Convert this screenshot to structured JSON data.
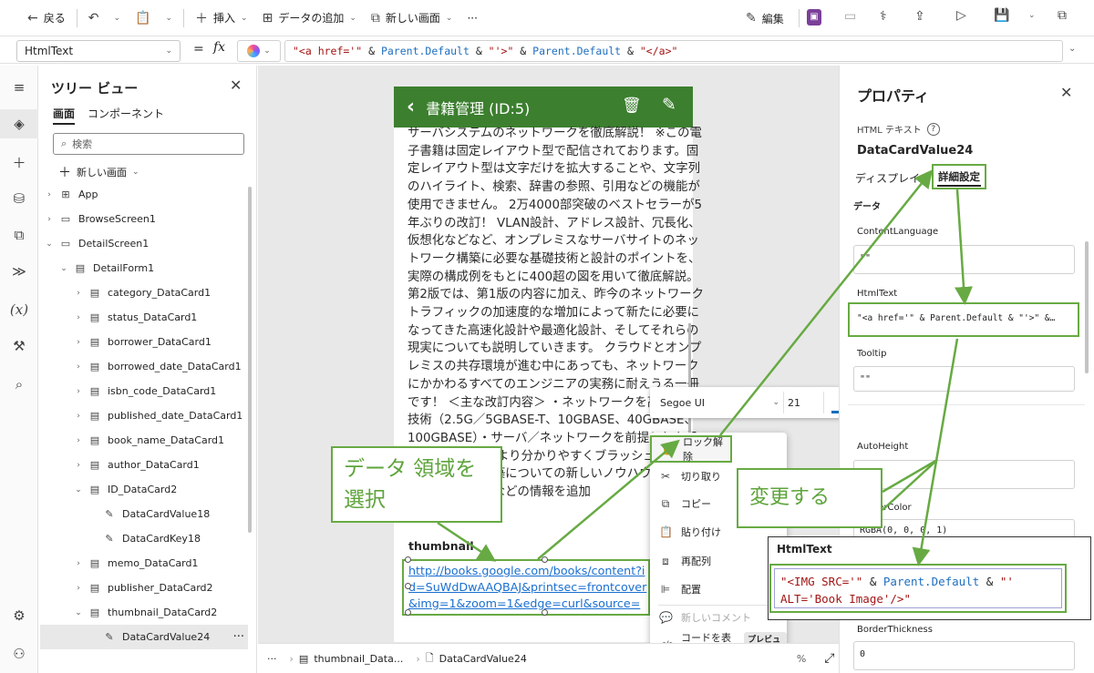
{
  "command_bar": {
    "back": "戻る",
    "insert": "挿入",
    "add_data": "データの追加",
    "new_screen": "新しい画面",
    "more": "···",
    "edit": "編集"
  },
  "formula_bar": {
    "property": "HtmlText",
    "eq": "=",
    "fx": "fx",
    "tokens": [
      "\"<a href='\"",
      " & ",
      "Parent.Default",
      " & ",
      "\"'>\"",
      " & ",
      "Parent.Default",
      " & ",
      "\"</a>\""
    ]
  },
  "tree": {
    "title": "ツリー ビュー",
    "tab_screens": "画面",
    "tab_components": "コンポーネント",
    "search_placeholder": "検索",
    "new_screen": "新しい画面",
    "items": [
      {
        "label": "App",
        "indent": 0,
        "caret": "›",
        "icon": "⊞"
      },
      {
        "label": "BrowseScreen1",
        "indent": 0,
        "caret": "›",
        "icon": "▭"
      },
      {
        "label": "DetailScreen1",
        "indent": 0,
        "caret": "⌄",
        "icon": "▭"
      },
      {
        "label": "DetailForm1",
        "indent": 1,
        "caret": "⌄",
        "icon": "▤"
      },
      {
        "label": "category_DataCard1",
        "indent": 2,
        "caret": "›",
        "icon": "▤"
      },
      {
        "label": "status_DataCard1",
        "indent": 2,
        "caret": "›",
        "icon": "▤"
      },
      {
        "label": "borrower_DataCard1",
        "indent": 2,
        "caret": "›",
        "icon": "▤"
      },
      {
        "label": "borrowed_date_DataCard1",
        "indent": 2,
        "caret": "›",
        "icon": "▤"
      },
      {
        "label": "isbn_code_DataCard1",
        "indent": 2,
        "caret": "›",
        "icon": "▤"
      },
      {
        "label": "published_date_DataCard1",
        "indent": 2,
        "caret": "›",
        "icon": "▤"
      },
      {
        "label": "book_name_DataCard1",
        "indent": 2,
        "caret": "›",
        "icon": "▤"
      },
      {
        "label": "author_DataCard1",
        "indent": 2,
        "caret": "›",
        "icon": "▤"
      },
      {
        "label": "ID_DataCard2",
        "indent": 2,
        "caret": "⌄",
        "icon": "▤"
      },
      {
        "label": "DataCardValue18",
        "indent": 3,
        "caret": "",
        "icon": "✎"
      },
      {
        "label": "DataCardKey18",
        "indent": 3,
        "caret": "",
        "icon": "✎"
      },
      {
        "label": "memo_DataCard1",
        "indent": 2,
        "caret": "›",
        "icon": "▤"
      },
      {
        "label": "publisher_DataCard2",
        "indent": 2,
        "caret": "›",
        "icon": "▤"
      },
      {
        "label": "thumbnail_DataCard2",
        "indent": 2,
        "caret": "⌄",
        "icon": "▤"
      },
      {
        "label": "DataCardValue24",
        "indent": 3,
        "caret": "",
        "icon": "✎",
        "selected": true
      }
    ]
  },
  "app_screen": {
    "title": "書籍管理 (ID:5)",
    "memo": "サーバシステムのネットワークを徹底解説！ ※この電子書籍は固定レイアウト型で配信されております。固定レイアウト型は文字だけを拡大することや、文字列のハイライト、検索、辞書の参照、引用などの機能が使用できません。 2万4000部突破のベストセラーが5年ぶりの改訂！ VLAN設計、アドレス設計、冗長化、仮想化などなど、オンプレミスなサーバサイトのネットワーク構築に必要な基礎技術と設計のポイントを、実際の構成例をもとに400超の図を用いて徹底解説。 第2版では、第1版の内容に加え、昨今のネットワークトラフィックの加速度的な増加によって新たに必要になってきた高速化設計や最適化設計、そしてそれらの現実についても説明していきます。 クラウドとオンプレミスの共存環境が進む中にあっても、ネットワークにかかわるすべてのエンジニアの実務に耐えうる一冊です！ ＜主な改訂内容＞ ・ネットワークを高速化する技術（2.5G／5GBASE-T、10GBASE、40GBASE、100GBASE）・サーバ／ネットワークを前提とした設計手法 ・解説をより分かりやすくブラッシュアップ ・ネットワーク構築についての新しいノウハウの追加 ・代表的な製品名などの情報を追加",
    "thumbnail_label": "thumbnail",
    "thumbnail_value": "http://books.google.com/books/content?id=SuWdDwAAQBAJ&printsec=frontcover&img=1&zoom=1&edge=curl&source=gbs_api"
  },
  "font_toolbar": {
    "font": "Segoe UI",
    "size": "21",
    "color_glyph": "A"
  },
  "context_menu": {
    "items": [
      {
        "label": "ロック解除",
        "icon": "🔒"
      },
      {
        "label": "切り取り",
        "icon": "✂"
      },
      {
        "label": "コピー",
        "icon": "⧉"
      },
      {
        "label": "貼り付け",
        "icon": "📋"
      },
      {
        "label": "再配列",
        "icon": "⧈"
      },
      {
        "label": "配置",
        "icon": "⊫"
      },
      {
        "label": "新しいコメント",
        "icon": "💬",
        "disabled": true
      },
      {
        "label": "コードを表示",
        "icon": "</>"
      }
    ],
    "preview_badge": "プレビュー"
  },
  "status_bar": {
    "more": "···",
    "crumb1": "thumbnail_Data...",
    "crumb2": "DataCardValue24",
    "zoom_suffix": "%"
  },
  "properties": {
    "title": "プロパティ",
    "type": "HTML テキスト",
    "name": "DataCardValue24",
    "tab_display": "ディスプレイ",
    "tab_advanced": "詳細設定",
    "section": "データ",
    "content_language_label": "ContentLanguage",
    "content_language_value": "\"\"",
    "htmltext_label": "HtmlText",
    "htmltext_value": "\"<a href='\" & Parent.Default & \"'>\" &…",
    "tooltip_label": "Tooltip",
    "tooltip_value": "\"\"",
    "autoheight_label": "AutoHeight",
    "bordercolor_label": "BorderColor",
    "bordercolor_value": "RGBA(0, 0, 0, 1)",
    "borderthickness_label": "BorderThickness",
    "borderthickness_value": "0"
  },
  "callouts": {
    "select_area": "データ 領域を\n選択",
    "change": "変更する"
  },
  "html_popup": {
    "title": "HtmlText",
    "line1_a": "\"<IMG SRC='\"",
    "line1_b": " & ",
    "line1_c": "Parent.Default",
    "line1_d": " & ",
    "line1_e": "\"'",
    "line2": "ALT='Book Image'/>\""
  },
  "colors": {
    "accent_green": "#67aa43",
    "header_green": "#3c7f2f",
    "link_blue": "#1a6fd0"
  }
}
